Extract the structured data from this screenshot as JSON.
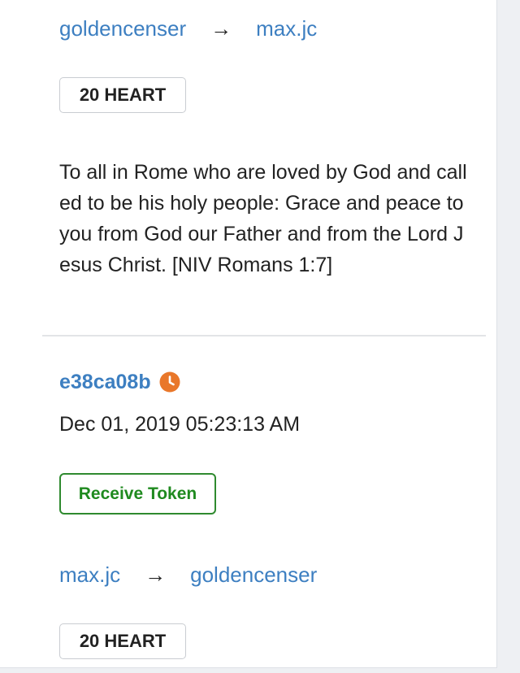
{
  "tx1": {
    "from": "goldencenser",
    "arrow": "→",
    "to": "max.jc",
    "amount": "20 HEART",
    "memo": "To all in Rome who are loved by God and called to be his holy people: Grace and peace to you from God our Father and from the Lord Jesus Christ. [NIV Romans 1:7]"
  },
  "tx2": {
    "id": "e38ca08b",
    "status_icon": "clock-icon",
    "timestamp": "Dec 01, 2019 05:23:13 AM",
    "type_label": "Receive Token",
    "from": "max.jc",
    "arrow": "→",
    "to": "goldencenser",
    "amount": "20 HEART"
  },
  "colors": {
    "link": "#3d7fc1",
    "pending": "#e9772a",
    "receive": "#1f8a1f",
    "text": "#222222"
  }
}
